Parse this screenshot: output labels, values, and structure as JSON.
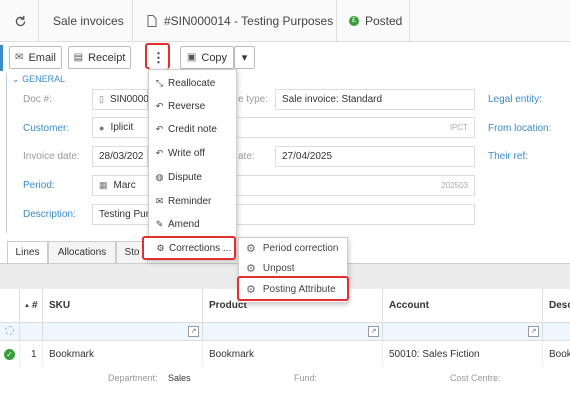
{
  "breadcrumb": {
    "home_icon": "refresh-icon",
    "section": "Sale invoices",
    "document": "#SIN000014 - Testing Purposes",
    "status": "Posted"
  },
  "toolbar": {
    "email": "Email",
    "receipt": "Receipt",
    "more": "⋮",
    "copy": "Copy",
    "dropdown": "▾"
  },
  "form": {
    "section_label": "GENERAL",
    "doc_no_label": "Doc #:",
    "doc_no_value": "SIN0000",
    "type_label": "e type:",
    "type_value": "Sale invoice: Standard",
    "legal_entity_label": "Legal entity:",
    "customer_label": "Customer:",
    "customer_value": "Iplicit",
    "customer_tag": "IPCT",
    "from_location_label": "From location:",
    "invoice_date_label": "Invoice date:",
    "invoice_date_value": "28/03/202",
    "due_date_label": "ate:",
    "due_date_value": "27/04/2025",
    "their_ref_label": "Their ref:",
    "period_label": "Period:",
    "period_value": "Marc",
    "period_tag": "202503",
    "description_label": "Description:",
    "description_value": "Testing Pur"
  },
  "tabs": [
    "Lines",
    "Allocations",
    "Sto"
  ],
  "grid": {
    "headers": [
      "#",
      "SKU",
      "Product",
      "Account",
      "Desc"
    ],
    "rows": [
      {
        "num": "1",
        "sku": "Bookmark",
        "product": "Bookmark",
        "account": "50010: Sales Fiction",
        "desc": "Book"
      }
    ],
    "footer": {
      "department_label": "Department:",
      "department_value": "Sales",
      "fund_label": "Fund:",
      "cost_centre_label": "Cost Centre:"
    }
  },
  "menu": {
    "items": [
      {
        "label": "Reallocate",
        "icon": "reallocate-icon"
      },
      {
        "label": "Reverse",
        "icon": "reverse-icon"
      },
      {
        "label": "Credit note",
        "icon": "credit-note-icon"
      },
      {
        "label": "Write off",
        "icon": "write-off-icon"
      },
      {
        "label": "Dispute",
        "icon": "dispute-icon"
      },
      {
        "label": "Reminder",
        "icon": "reminder-icon"
      },
      {
        "label": "Amend",
        "icon": "amend-icon"
      },
      {
        "label": "Corrections ...",
        "icon": "gear-icon"
      }
    ]
  },
  "submenu": {
    "items": [
      {
        "label": "Period correction",
        "icon": "gear-icon"
      },
      {
        "label": "Unpost",
        "icon": "gear-icon"
      },
      {
        "label": "Posting Attribute",
        "icon": "gear-icon"
      }
    ]
  },
  "colors": {
    "accent": "#3a8bc8",
    "highlight": "#e03030",
    "posted": "#3a9d3a"
  }
}
